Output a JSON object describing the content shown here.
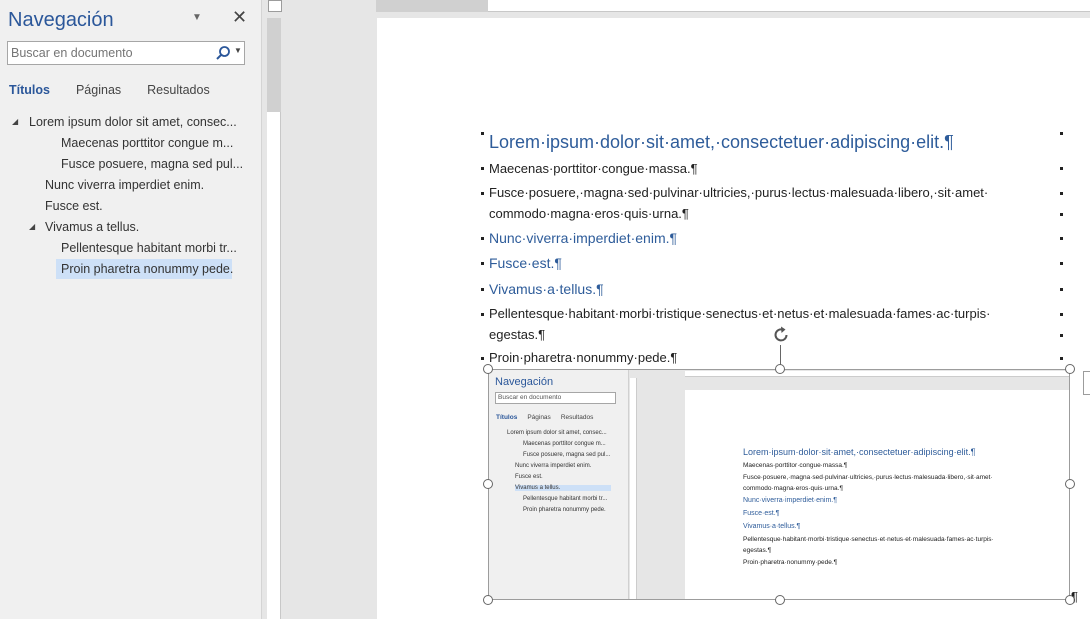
{
  "nav": {
    "title": "Navegación",
    "search_placeholder": "Buscar en documento",
    "tabs": [
      {
        "label": "Títulos",
        "active": true
      },
      {
        "label": "Páginas",
        "active": false
      },
      {
        "label": "Resultados",
        "active": false
      }
    ],
    "tree": [
      {
        "label": "Lorem ipsum dolor sit amet, consec...",
        "level": 1,
        "expanded": true
      },
      {
        "label": "Maecenas porttitor congue m...",
        "level": 3
      },
      {
        "label": "Fusce posuere, magna sed pul...",
        "level": 3
      },
      {
        "label": "Nunc viverra imperdiet enim.",
        "level": 2
      },
      {
        "label": "Fusce est.",
        "level": 2
      },
      {
        "label": "Vivamus a tellus.",
        "level": 2,
        "expanded": true
      },
      {
        "label": "Pellentesque habitant morbi tr...",
        "level": 3
      },
      {
        "label": "Proin pharetra nonummy pede.",
        "level": 3,
        "selected": true
      }
    ]
  },
  "document": {
    "paragraphs": [
      {
        "text": "Lorem·ipsum·dolor·sit·amet,·consectetuer·adipiscing·elit.¶",
        "style": "h1"
      },
      {
        "text": "Maecenas·porttitor·congue·massa.¶",
        "style": "body"
      },
      {
        "text": "Fusce·posuere,·magna·sed·pulvinar·ultricies,·purus·lectus·malesuada·libero,·sit·amet·",
        "style": "body"
      },
      {
        "text": "commodo·magna·eros·quis·urna.¶",
        "style": "body"
      },
      {
        "text": "Nunc·viverra·imperdiet·enim.¶",
        "style": "h2"
      },
      {
        "text": "Fusce·est.¶",
        "style": "h2"
      },
      {
        "text": "Vivamus·a·tellus.¶",
        "style": "h2"
      },
      {
        "text": "Pellentesque·habitant·morbi·tristique·senectus·et·netus·et·malesuada·fames·ac·turpis·",
        "style": "body"
      },
      {
        "text": "egestas.¶",
        "style": "body"
      },
      {
        "text": "Proin·pharetra·nonummy·pede.¶",
        "style": "body"
      }
    ],
    "end_mark": "¶"
  },
  "embedded_screenshot": {
    "nav_title": "Navegación",
    "search_placeholder": "Buscar en documento",
    "tabs": [
      "Títulos",
      "Páginas",
      "Resultados"
    ],
    "tree": [
      "Lorem ipsum dolor sit amet, consec...",
      "Maecenas porttitor congue m...",
      "Fusce posuere, magna sed pul...",
      "Nunc viverra imperdiet enim.",
      "Fusce est.",
      "Vivamus a tellus.",
      "Pellentesque habitant morbi tr...",
      "Proin pharetra nonummy pede."
    ],
    "paragraphs": [
      "Lorem·ipsum·dolor·sit·amet,·consectetuer·adipiscing·elit.¶",
      "Maecenas·porttitor·congue·massa.¶",
      "Fusce·posuere,·magna·sed·pulvinar·ultricies,·purus·lectus·malesuada·libero,·sit·amet·",
      "commodo·magna·eros·quis·urna.¶",
      "Nunc·viverra·imperdiet·enim.¶",
      "Fusce·est.¶",
      "Vivamus·a·tellus.¶",
      "Pellentesque·habitant·morbi·tristique·senectus·et·netus·et·malesuada·fames·ac·turpis·",
      "egestas.¶",
      "Proin·pharetra·nonummy·pede.¶"
    ]
  },
  "colors": {
    "accent": "#2b579a",
    "heading": "#2e5c9a",
    "selection": "#cde0f7"
  }
}
